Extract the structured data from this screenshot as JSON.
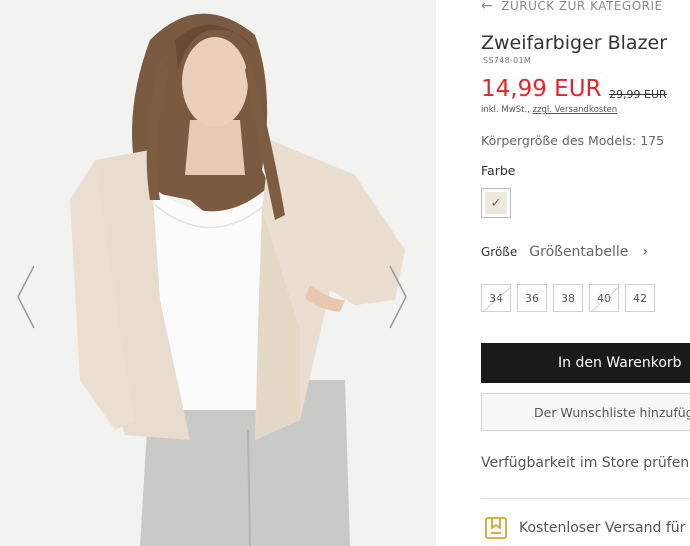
{
  "gallery": {
    "prev_icon": "chevron-left-icon",
    "next_icon": "chevron-right-icon",
    "image_subject": "model-photo"
  },
  "product": {
    "back_link": "ZURÜCK ZUR KATEGORIE",
    "title": "Zweifarbiger Blazer",
    "sku": "SS748-01M",
    "price": "14,99 EUR",
    "old_price": "29,99 EUR",
    "tax_text": "inkl. MwSt.,",
    "shipping_link": "zzgl. Versandkosten",
    "model_height": "Körpergröße des Models: 175",
    "color_label": "Farbe",
    "size_label": "Größe",
    "size_table": "Größentabelle",
    "sizes": [
      {
        "label": "34",
        "available": false
      },
      {
        "label": "36",
        "available": true
      },
      {
        "label": "38",
        "available": true
      },
      {
        "label": "40",
        "available": false
      },
      {
        "label": "42",
        "available": true
      }
    ],
    "add_to_cart": "In den Warenkorb",
    "wishlist": "Der Wunschliste hinzufügen",
    "store_availability": "Verfügbarkeit im Store prüfen",
    "free_shipping": "Kostenloser Versand für"
  },
  "colors": {
    "price": "#e4242b",
    "cart_button": "#1a1a1a",
    "swatch": "#eee9dd"
  }
}
